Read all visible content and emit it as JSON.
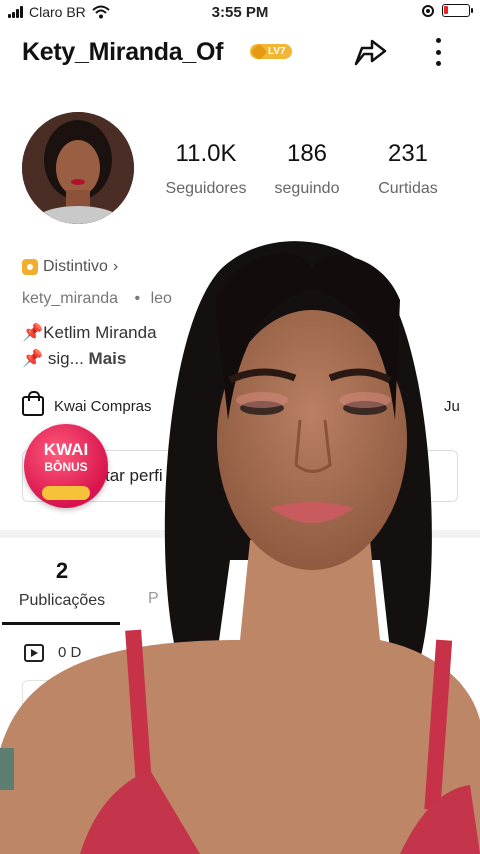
{
  "status_bar": {
    "carrier": "Claro BR",
    "time": "3:55 PM",
    "battery_level": 0.15
  },
  "header": {
    "username": "Kety_Miranda_Of",
    "level_badge": "LV7"
  },
  "stats": [
    {
      "value": "11.0K",
      "label": "Seguidores"
    },
    {
      "value": "186",
      "label": "seguindo"
    },
    {
      "value": "231",
      "label": "Curtidas"
    }
  ],
  "profile": {
    "badge_label": "Distintivo",
    "handle": "kety_miranda",
    "handle_extra": "leo",
    "bio_line1": "Ketlim Miranda",
    "bio_line2": "sig...",
    "bio_more": "Mais"
  },
  "shop": {
    "label": "Kwai Compras",
    "right_truncated": "Ju"
  },
  "edit_button": {
    "label_fragment": "tar perfi"
  },
  "bonus": {
    "line1": "KWAI",
    "line2": "BÔNUS"
  },
  "tabs": {
    "publications_count": "2",
    "publications_label": "Publicações",
    "next_truncated": "P",
    "drafts_truncated": "0 D"
  },
  "colors": {
    "accent_gold": "#f3b634",
    "bonus_pink": "#d8144e",
    "pin_red": "#d9252b"
  }
}
